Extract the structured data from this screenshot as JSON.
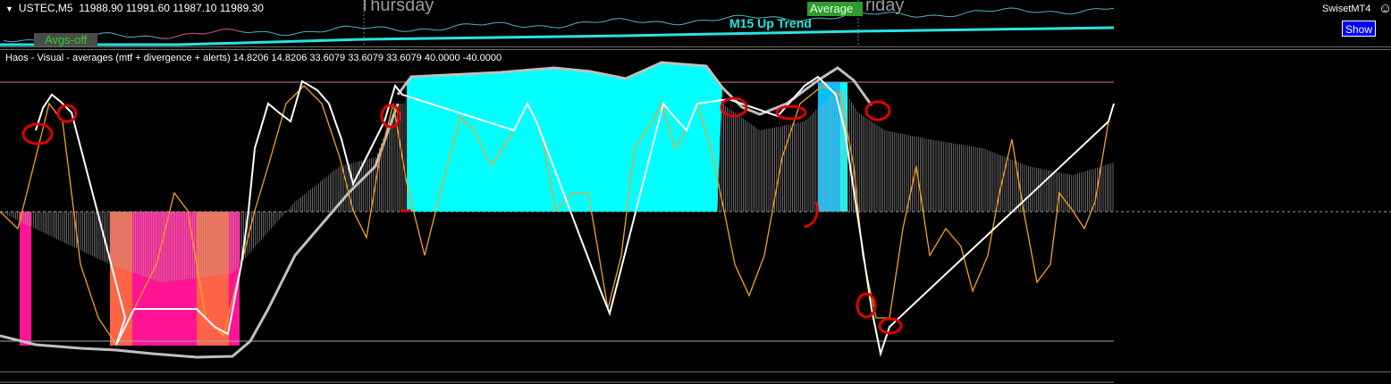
{
  "window": {
    "symbol": "USTEC,M5",
    "ohlc": "11988.90 11991.60 11987.10 11989.30",
    "day_labels": [
      "Thursday",
      "riday"
    ],
    "avgs_off_label": "Avgs-off",
    "average_label": "Average",
    "trend_label": "M15 Up Trend",
    "ea_label": "SwisetMT4",
    "show_button": "Show"
  },
  "indicator": {
    "title": "Haos - Visual - averages (mtf + divergence + alerts) 14.8206 14.8206 33.6079 33.6079 33.6079 40.0000 -40.0000",
    "levels": [
      40,
      0,
      -40
    ],
    "colors": {
      "up_strong": "#00ffff",
      "up_mid": "#00bfff",
      "down_strong": "#ff1493",
      "down_mid": "#ff6347",
      "histogram": "#a9a9a9",
      "signal": "#f4a21f",
      "envelope": "#c0c0c0",
      "markup": "#e00000",
      "trend_line": "#28e3e3"
    }
  }
}
